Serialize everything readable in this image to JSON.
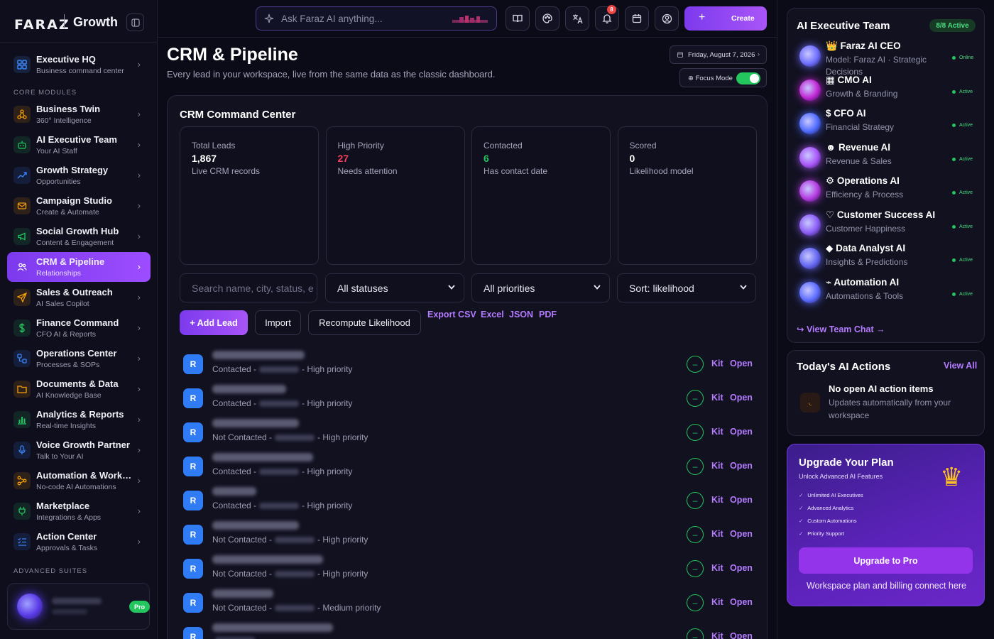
{
  "brand": {
    "logo": "FARAZ",
    "name": "Growth"
  },
  "sidebar": {
    "top_item": {
      "title": "Executive HQ",
      "sub": "Business command center"
    },
    "section_core": "CORE MODULES",
    "section_advanced": "ADVANCED SUITES",
    "items": [
      {
        "title": "Business Twin",
        "sub": "360° Intelligence",
        "icon": "network-icon",
        "color": "#f59e0b"
      },
      {
        "title": "AI Executive Team",
        "sub": "Your AI Staff",
        "icon": "robot-icon",
        "color": "#22c55e"
      },
      {
        "title": "Growth Strategy",
        "sub": "Opportunities",
        "icon": "trend-up-icon",
        "color": "#3b82f6"
      },
      {
        "title": "Campaign Studio",
        "sub": "Create & Automate",
        "icon": "mail-icon",
        "color": "#f59e0b"
      },
      {
        "title": "Social Growth Hub",
        "sub": "Content & Engagement",
        "icon": "megaphone-icon",
        "color": "#22c55e"
      },
      {
        "title": "CRM & Pipeline",
        "sub": "Relationships",
        "icon": "users-icon",
        "color": "#ffffff"
      },
      {
        "title": "Sales & Outreach",
        "sub": "AI Sales Copilot",
        "icon": "send-icon",
        "color": "#f59e0b"
      },
      {
        "title": "Finance Command",
        "sub": "CFO AI & Reports",
        "icon": "dollar-icon",
        "color": "#22c55e"
      },
      {
        "title": "Operations Center",
        "sub": "Processes & SOPs",
        "icon": "workflow-icon",
        "color": "#3b82f6"
      },
      {
        "title": "Documents & Data",
        "sub": "AI Knowledge Base",
        "icon": "folder-icon",
        "color": "#f59e0b"
      },
      {
        "title": "Analytics & Reports",
        "sub": "Real-time Insights",
        "icon": "bar-chart-icon",
        "color": "#22c55e"
      },
      {
        "title": "Voice Growth Partner",
        "sub": "Talk to Your AI",
        "icon": "mic-icon",
        "color": "#3b82f6"
      },
      {
        "title": "Automation & Workflows",
        "sub": "No-code AI Automations",
        "icon": "automation-icon",
        "color": "#f59e0b"
      },
      {
        "title": "Marketplace",
        "sub": "Integrations & Apps",
        "icon": "plug-icon",
        "color": "#22c55e"
      },
      {
        "title": "Action Center",
        "sub": "Approvals & Tasks",
        "icon": "checklist-icon",
        "color": "#3b82f6"
      }
    ],
    "user_badge": "Pro"
  },
  "topbar": {
    "search_placeholder": "Ask Faraz AI anything...",
    "notification_count": "8",
    "create_label": "Create"
  },
  "page": {
    "title": "CRM & Pipeline",
    "subtitle": "Every lead in your workspace, live from the same data as the classic dashboard.",
    "date": "Friday, August 7, 2026",
    "focus_mode_label": "⊕ Focus Mode"
  },
  "crm": {
    "title": "CRM Command Center",
    "stats": [
      {
        "label": "Total Leads",
        "value": "1,867",
        "sub": "Live CRM records",
        "color": "#ffffff"
      },
      {
        "label": "High Priority",
        "value": "27",
        "sub": "Needs attention",
        "color": "#f43f5e"
      },
      {
        "label": "Contacted",
        "value": "6",
        "sub": "Has contact date",
        "color": "#22c55e"
      },
      {
        "label": "Scored",
        "value": "0",
        "sub": "Likelihood model",
        "color": "#ffffff"
      }
    ],
    "search_placeholder": "Search name, city, status, e",
    "filters": {
      "status": "All statuses",
      "priority": "All priorities",
      "sort": "Sort: likelihood"
    },
    "buttons": {
      "add": "+ Add Lead",
      "import": "Import",
      "recompute": "Recompute Likelihood"
    },
    "exports": [
      "Export CSV",
      "Excel",
      "JSON",
      "PDF"
    ],
    "row_kit": "Kit",
    "row_open": "Open",
    "leads": [
      {
        "initial": "R",
        "status": "Contacted -",
        "priority": "- High priority"
      },
      {
        "initial": "R",
        "status": "Contacted -",
        "priority": "- High priority"
      },
      {
        "initial": "R",
        "status": "Not Contacted -",
        "priority": "- High priority"
      },
      {
        "initial": "R",
        "status": "Contacted -",
        "priority": "- High priority"
      },
      {
        "initial": "R",
        "status": "Contacted -",
        "priority": "- High priority"
      },
      {
        "initial": "R",
        "status": "Not Contacted -",
        "priority": "- High priority"
      },
      {
        "initial": "R",
        "status": "Not Contacted -",
        "priority": "- High priority"
      },
      {
        "initial": "R",
        "status": "Not Contacted -",
        "priority": "- Medium priority"
      },
      {
        "initial": "R",
        "status": "",
        "priority": ""
      }
    ]
  },
  "team": {
    "title": "AI Executive Team",
    "active_badge": "8/8 Active",
    "view_chat": "↪ View Team Chat →",
    "members": [
      {
        "name": "👑 Faraz AI CEO",
        "desc": "Model: Faraz AI · Strategic Decisions",
        "status": "Online",
        "orb": "#6d6dff"
      },
      {
        "name": "▦ CMO AI",
        "desc": "Growth & Branding",
        "status": "Active",
        "orb": "#c026d3"
      },
      {
        "name": "$ CFO AI",
        "desc": "Financial Strategy",
        "status": "Active",
        "orb": "#4f6bff"
      },
      {
        "name": "☻ Revenue AI",
        "desc": "Revenue & Sales",
        "status": "Active",
        "orb": "#a855f7"
      },
      {
        "name": "⚙ Operations AI",
        "desc": "Efficiency & Process",
        "status": "Active",
        "orb": "#b43ae0"
      },
      {
        "name": "♡ Customer Success AI",
        "desc": "Customer Happiness",
        "status": "Active",
        "orb": "#8b5cf6"
      },
      {
        "name": "◆ Data Analyst AI",
        "desc": "Insights & Predictions",
        "status": "Active",
        "orb": "#6366f1"
      },
      {
        "name": "⌁ Automation AI",
        "desc": "Automations & Tools",
        "status": "Active",
        "orb": "#5b6cff"
      }
    ]
  },
  "actions": {
    "title": "Today's AI Actions",
    "view_all": "View All",
    "empty_title": "No open AI action items",
    "empty_sub": "Updates automatically from your workspace"
  },
  "upgrade": {
    "title": "Upgrade Your Plan",
    "sub": "Unlock Advanced AI Features",
    "features": [
      "Unlimited AI Executives",
      "Advanced Analytics",
      "Custom Automations",
      "Priority Support"
    ],
    "button": "Upgrade to Pro",
    "note": "Workspace plan and billing connect here"
  },
  "colors": {
    "accent": "#8b5cf6",
    "success": "#22c55e",
    "danger": "#f43f5e",
    "link": "#b57bff"
  }
}
